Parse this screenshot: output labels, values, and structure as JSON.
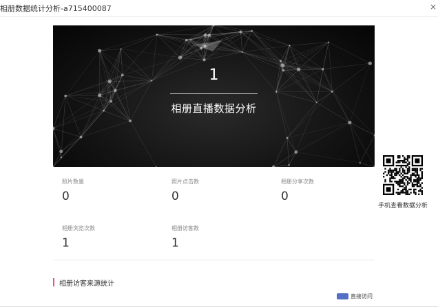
{
  "window": {
    "title": "相册数据统计分析-a715400087",
    "close_glyph": "×"
  },
  "banner": {
    "number": "1",
    "title": "相册直播数据分析"
  },
  "stats": [
    {
      "label": "照片数量",
      "value": "0"
    },
    {
      "label": "照片点击数",
      "value": "0"
    },
    {
      "label": "相册分享次数",
      "value": "0"
    },
    {
      "label": "相册浏览次数",
      "value": "1"
    },
    {
      "label": "相册访客数",
      "value": "1"
    }
  ],
  "qr": {
    "caption": "手机查看数据分析"
  },
  "source_section": {
    "title": "相册访客来源统计",
    "accent_color": "#e8557a",
    "legend": [
      {
        "label": "直接访问",
        "color": "#5470c6"
      }
    ]
  }
}
